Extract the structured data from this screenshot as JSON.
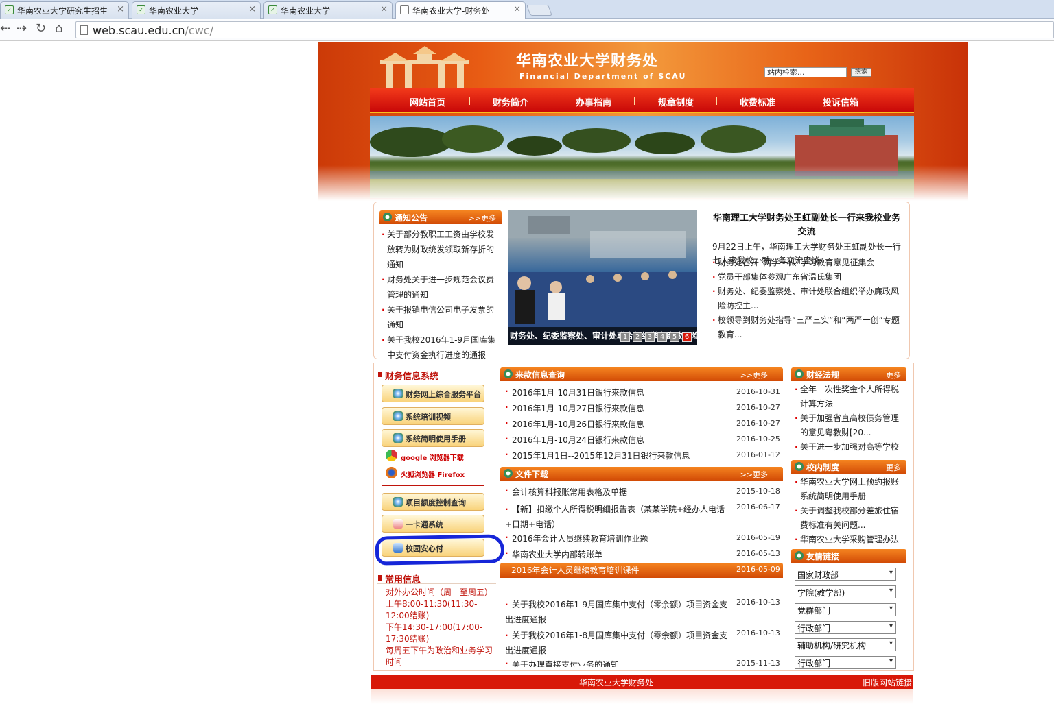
{
  "browser": {
    "tabs": [
      {
        "title": "华南农业大学研究生招生"
      },
      {
        "title": "华南农业大学"
      },
      {
        "title": "华南农业大学"
      },
      {
        "title": "华南农业大学-财务处"
      }
    ],
    "url_host": "web.scau.edu.cn",
    "url_path": "/cwc/"
  },
  "header": {
    "title": "华南农业大学财务处",
    "subtitle": "Financial Department of SCAU",
    "search_placeholder": "站内检索...",
    "search_button": "搜索"
  },
  "nav": [
    "网站首页",
    "财务简介",
    "办事指南",
    "规章制度",
    "收费标准",
    "投诉信箱"
  ],
  "notices": {
    "title": "通知公告",
    "more": ">>更多",
    "items": [
      "关于部分教职工工资由学校发放转为财政统发领取新存折的通知",
      "财务处关于进一步规范会议费管理的通知",
      "关于报销电信公司电子发票的通知",
      "关于我校2016年1-9月国库集中支付资金执行进度的通报"
    ]
  },
  "photo": {
    "caption": "财务处、纪委监察处、审计处联合组织举办廉政风险",
    "pages": [
      "1",
      "2",
      "3",
      "4",
      "5",
      "6"
    ]
  },
  "feature": {
    "title": "华南理工大学财务处王虹副处长一行来我校业务交流",
    "summary": "9月22日上午，华南理工大学财务处王虹副处长一行七人来我校，就业务交流座谈...",
    "items": [
      "财务处召开“两学一做”学习教育意见征集会",
      "党员干部集体参观广东省温氏集团",
      "财务处、纪委监察处、审计处联合组织举办廉政风险防控主...",
      "校领导到财务处指导“三严三实”和“两严一创”专题教育..."
    ]
  },
  "finance_system": {
    "title": "财务信息系统",
    "buttons": [
      "财务网上综合服务平台",
      "系统培训视频",
      "系统简明使用手册"
    ],
    "browsers": [
      "google 浏览器下载",
      "火狐浏览器 Firefox"
    ],
    "buttons2": [
      "项目额度控制查询",
      "一卡通系统",
      "校园安心付"
    ]
  },
  "common_info": {
    "title": "常用信息",
    "lines": [
      "对外办公时间（周一至周五）",
      "上午8:00-11:30(11:30-12:00结账)",
      "下午14:30-17:00(17:00-17:30结账)",
      "每周五下午为政治和业务学习时间"
    ]
  },
  "income_query": {
    "title": "来款信息查询",
    "more": ">>更多",
    "rows": [
      {
        "text": "2016年1月-10月31日银行来款信息",
        "date": "2016-10-31"
      },
      {
        "text": "2016年1月-10月27日银行来款信息",
        "date": "2016-10-27"
      },
      {
        "text": "2016年1月-10月26日银行来款信息",
        "date": "2016-10-27"
      },
      {
        "text": "2016年1月-10月24日银行来款信息",
        "date": "2016-10-25"
      },
      {
        "text": "2015年1月1日--2015年12月31日银行来款信息",
        "date": "2016-01-12"
      }
    ]
  },
  "downloads": {
    "title": "文件下载",
    "more": ">>更多",
    "rows": [
      {
        "text": "会计核算科报账常用表格及单据",
        "date": "2015-10-18"
      },
      {
        "text": "【新】扣缴个人所得税明细报告表（某某学院+经办人电话+日期+电话）",
        "date": "2016-06-17"
      },
      {
        "text": "2016年会计人员继续教育培训作业题",
        "date": "2016-05-19"
      },
      {
        "text": "华南农业大学内部转账单",
        "date": "2016-05-13"
      },
      {
        "text": "2016年会计人员继续教育培训课件",
        "date": "2016-05-09"
      }
    ]
  },
  "reports": {
    "rows": [
      {
        "text": "关于我校2016年1-9月国库集中支付（零余额）项目资金支出进度通报",
        "date": "2016-10-13"
      },
      {
        "text": "关于我校2016年1-8月国库集中支付（零余额）项目资金支出进度通报",
        "date": "2016-10-13"
      },
      {
        "text": "关于办理直接支付业务的通知",
        "date": "2015-11-13"
      }
    ]
  },
  "regulations": {
    "title": "财经法规",
    "more": "更多",
    "items": [
      "全年一次性奖金个人所得税计算方法",
      "关于加强省直高校债务管理的意见粤教财[20...",
      "关于进一步加强对高等学校"
    ]
  },
  "internal_rules": {
    "title": "校内制度",
    "more": "更多",
    "items": [
      "华南农业大学网上预约报账系统简明使用手册",
      "关于调整我校部分差旅住宿费标准有关问题...",
      "华南农业大学采购管理办法"
    ]
  },
  "links": {
    "title": "友情链接",
    "options": [
      "国家财政部",
      "学院(教学部)",
      "党群部门",
      "行政部门",
      "辅助机构/研究机构",
      "行政部门"
    ]
  },
  "footer": {
    "title": "华南农业大学财务处",
    "old_site": "旧版网站链接"
  },
  "colors": {
    "header_red": "#d81808",
    "accent_orange": "#e85c14",
    "highlight_blue": "#1626d8"
  }
}
